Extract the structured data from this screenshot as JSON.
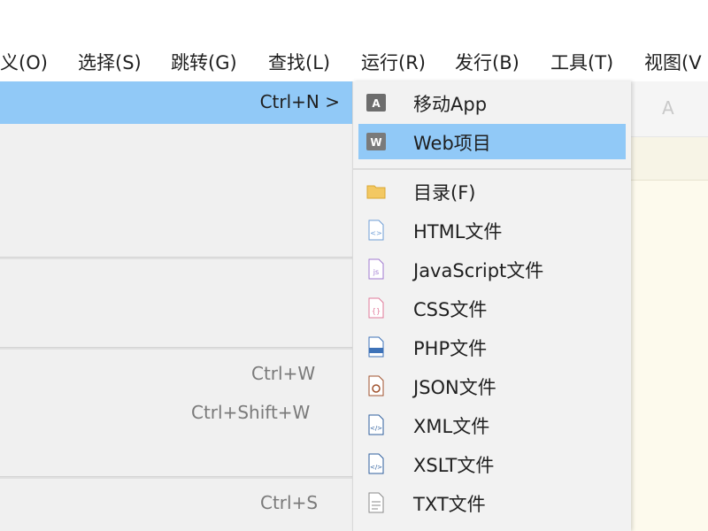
{
  "menubar": {
    "items": [
      "义(O)",
      "选择(S)",
      "跳转(G)",
      "查找(L)",
      "运行(R)",
      "发行(B)",
      "工具(T)",
      "视图(V"
    ]
  },
  "left_menu": {
    "highlight_shortcut": "Ctrl+N >",
    "shortcuts": [
      "Ctrl+W",
      "Ctrl+Shift+W",
      "Ctrl+S"
    ]
  },
  "submenu": {
    "items": [
      {
        "label": "移动App",
        "icon": "mobile-app-icon",
        "selected": false
      },
      {
        "label": "Web项目",
        "icon": "web-project-icon",
        "selected": true
      },
      {
        "label": "目录(F)",
        "icon": "folder-icon",
        "selected": false
      },
      {
        "label": "HTML文件",
        "icon": "html-file-icon",
        "selected": false
      },
      {
        "label": "JavaScript文件",
        "icon": "javascript-file-icon",
        "selected": false
      },
      {
        "label": "CSS文件",
        "icon": "css-file-icon",
        "selected": false
      },
      {
        "label": "PHP文件",
        "icon": "php-file-icon",
        "selected": false
      },
      {
        "label": "JSON文件",
        "icon": "json-file-icon",
        "selected": false
      },
      {
        "label": "XML文件",
        "icon": "xml-file-icon",
        "selected": false
      },
      {
        "label": "XSLT文件",
        "icon": "xslt-file-icon",
        "selected": false
      },
      {
        "label": "TXT文件",
        "icon": "txt-file-icon",
        "selected": false
      }
    ]
  },
  "colors": {
    "highlight": "#91c9f7",
    "menu_bg": "#f0f0f0",
    "editor_bg": "#fdfaed"
  }
}
